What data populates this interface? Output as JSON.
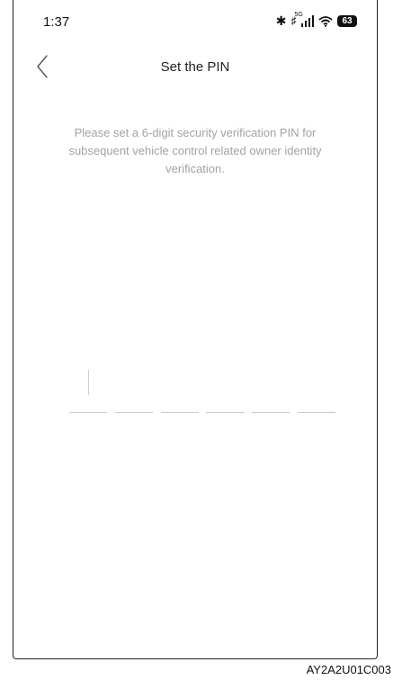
{
  "status_bar": {
    "time": "1:37",
    "network_tag": "5G",
    "battery": "63",
    "icons": [
      "bluetooth-icon",
      "mute-icon",
      "signal-icon",
      "wifi-icon",
      "battery-icon"
    ]
  },
  "nav": {
    "back_icon": "chevron-left-icon",
    "title": "Set the PIN"
  },
  "instruction": "Please set a 6-digit security verification PIN for subsequent vehicle control related owner identity verification.",
  "pin": {
    "length": 6,
    "entered": ""
  },
  "figure_code": "AY2A2U01C003",
  "colors": {
    "background": "#ffffff",
    "title_text": "#222222",
    "hint_text": "#a3a3a3",
    "pin_underline": "#c8c8c8"
  }
}
